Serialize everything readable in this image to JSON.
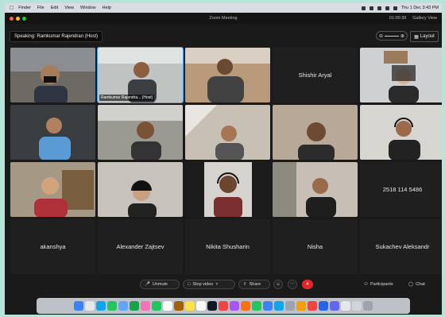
{
  "menubar": {
    "apple": "",
    "items": [
      "Finder",
      "File",
      "Edit",
      "View",
      "Window",
      "Help"
    ],
    "clock": "Thu 1 Dec 3:43 PM"
  },
  "window": {
    "title": "Zoom Meeting",
    "timer": "01:00:39",
    "view": "Gallery View"
  },
  "top": {
    "speaking_prefix": "Speaking:",
    "speaking_name": "Ramkumar Rajendran (Host)",
    "layout_label": "Layout"
  },
  "tiles": [
    {
      "kind": "video",
      "label": ""
    },
    {
      "kind": "video",
      "label": "Ramkumar Rajendra... (Host)",
      "active": true
    },
    {
      "kind": "video",
      "label": ""
    },
    {
      "kind": "name",
      "label": "Shishir Aryal"
    },
    {
      "kind": "video",
      "label": ""
    },
    {
      "kind": "video",
      "label": ""
    },
    {
      "kind": "video",
      "label": ""
    },
    {
      "kind": "video",
      "label": ""
    },
    {
      "kind": "video",
      "label": ""
    },
    {
      "kind": "video",
      "label": ""
    },
    {
      "kind": "video",
      "label": ""
    },
    {
      "kind": "video",
      "label": ""
    },
    {
      "kind": "video",
      "label": ""
    },
    {
      "kind": "video",
      "label": ""
    },
    {
      "kind": "name",
      "label": "2518 114 5486"
    },
    {
      "kind": "name",
      "label": "akanshya"
    },
    {
      "kind": "name",
      "label": "Alexander Zajtsev"
    },
    {
      "kind": "name",
      "label": "Nikita Shusharin"
    },
    {
      "kind": "name",
      "label": "Nisha"
    },
    {
      "kind": "name",
      "label": "Sukachev Aleksandr"
    }
  ],
  "controls": {
    "unmute": "Unmute",
    "stop_video": "Stop video",
    "share": "Share",
    "participants": "Participants",
    "chat": "Chat"
  }
}
